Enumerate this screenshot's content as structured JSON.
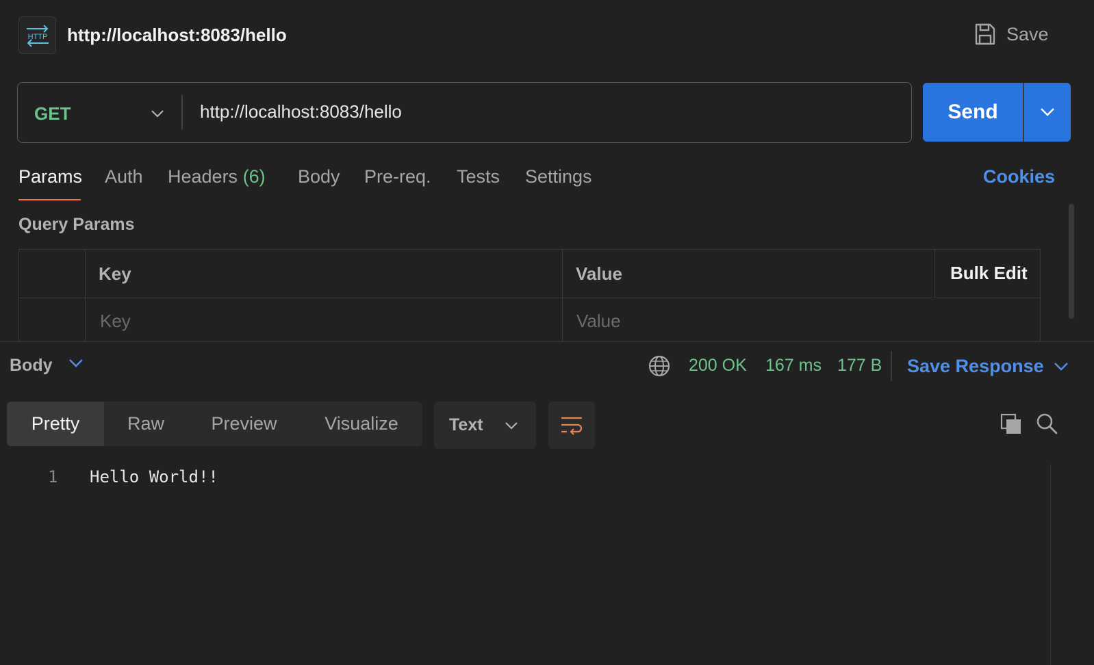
{
  "header": {
    "badge_text": "HTTP",
    "title": "http://localhost:8083/hello",
    "save_label": "Save"
  },
  "request": {
    "method": "GET",
    "url": "http://localhost:8083/hello",
    "send_label": "Send"
  },
  "tabs": {
    "params": "Params",
    "auth": "Auth",
    "headers": "Headers",
    "headers_count": "(6)",
    "body": "Body",
    "prereq": "Pre-req.",
    "tests": "Tests",
    "settings": "Settings",
    "cookies": "Cookies"
  },
  "query_params": {
    "title": "Query Params",
    "col_key": "Key",
    "col_value": "Value",
    "bulk_edit": "Bulk Edit",
    "key_placeholder": "Key",
    "value_placeholder": "Value"
  },
  "response": {
    "section_label": "Body",
    "status": "200 OK",
    "time": "167 ms",
    "size": "177 B",
    "save_response": "Save Response",
    "views": [
      "Pretty",
      "Raw",
      "Preview",
      "Visualize"
    ],
    "format": "Text",
    "lines": [
      {
        "num": "1",
        "text": "Hello World!!"
      }
    ]
  },
  "colors": {
    "accent_orange": "#ff6c37",
    "send_blue": "#2a74e0",
    "link_blue": "#4f8fe8",
    "success_green": "#6cc48c",
    "http_icon": "#5ec3e0"
  },
  "icons": [
    "http-icon",
    "save-icon",
    "chevron-down-icon",
    "globe-icon",
    "wrap-lines-icon",
    "copy-icon",
    "search-icon"
  ]
}
